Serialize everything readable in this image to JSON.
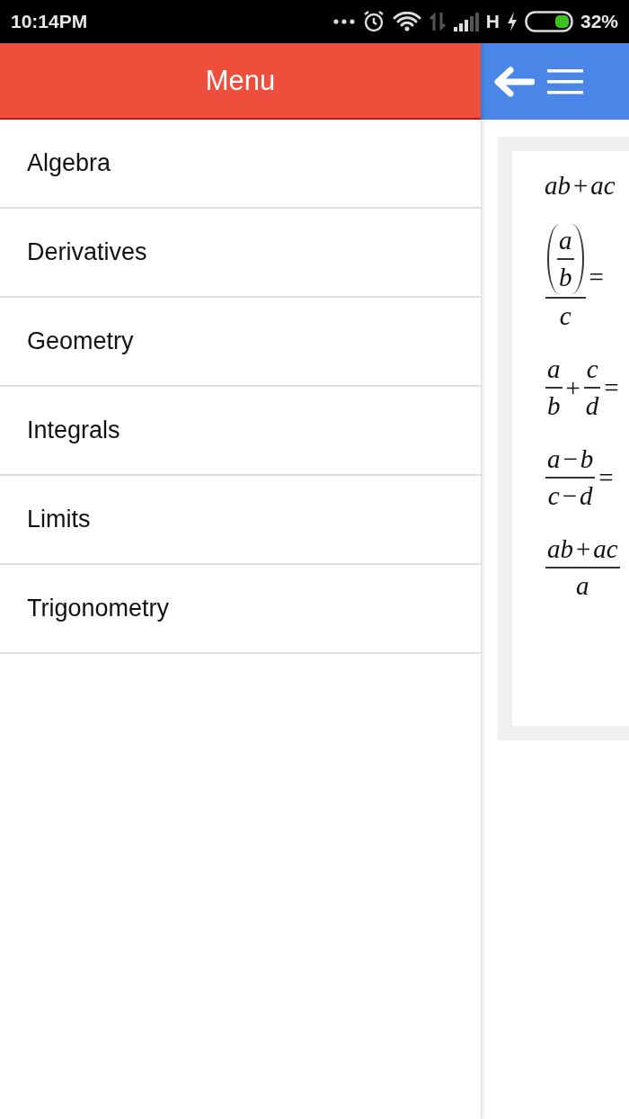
{
  "status_bar": {
    "time": "10:14PM",
    "network_type": "H",
    "battery_percent": "32%"
  },
  "drawer": {
    "title": "Menu",
    "items": [
      {
        "label": "Algebra"
      },
      {
        "label": "Derivatives"
      },
      {
        "label": "Geometry"
      },
      {
        "label": "Integrals"
      },
      {
        "label": "Limits"
      },
      {
        "label": "Trigonometry"
      }
    ]
  },
  "formulas": [
    {
      "terms": [
        {
          "kind": "var",
          "text": "ab"
        },
        {
          "kind": "op",
          "text": "+"
        },
        {
          "kind": "var",
          "text": "ac"
        }
      ]
    },
    {
      "terms": [
        {
          "kind": "fraction",
          "num": [
            {
              "kind": "paren",
              "inner": [
                {
                  "kind": "fraction",
                  "num": [
                    {
                      "kind": "var",
                      "text": "a"
                    }
                  ],
                  "den": [
                    {
                      "kind": "var",
                      "text": "b"
                    }
                  ]
                }
              ]
            }
          ],
          "den": [
            {
              "kind": "var",
              "text": "c"
            }
          ]
        },
        {
          "kind": "op",
          "text": "="
        }
      ]
    },
    {
      "terms": [
        {
          "kind": "fraction",
          "num": [
            {
              "kind": "var",
              "text": "a"
            }
          ],
          "den": [
            {
              "kind": "var",
              "text": "b"
            }
          ]
        },
        {
          "kind": "op",
          "text": "+"
        },
        {
          "kind": "fraction",
          "num": [
            {
              "kind": "var",
              "text": "c"
            }
          ],
          "den": [
            {
              "kind": "var",
              "text": "d"
            }
          ]
        },
        {
          "kind": "op",
          "text": "="
        }
      ]
    },
    {
      "terms": [
        {
          "kind": "fraction",
          "num": [
            {
              "kind": "var",
              "text": "a"
            },
            {
              "kind": "op",
              "text": "−"
            },
            {
              "kind": "var",
              "text": "b"
            }
          ],
          "den": [
            {
              "kind": "var",
              "text": "c"
            },
            {
              "kind": "op",
              "text": "−"
            },
            {
              "kind": "var",
              "text": "d"
            }
          ]
        },
        {
          "kind": "op",
          "text": "="
        }
      ]
    },
    {
      "terms": [
        {
          "kind": "fraction",
          "num": [
            {
              "kind": "var",
              "text": "ab"
            },
            {
              "kind": "op",
              "text": "+"
            },
            {
              "kind": "var",
              "text": "ac"
            }
          ],
          "den": [
            {
              "kind": "var",
              "text": "a"
            }
          ]
        }
      ]
    }
  ]
}
